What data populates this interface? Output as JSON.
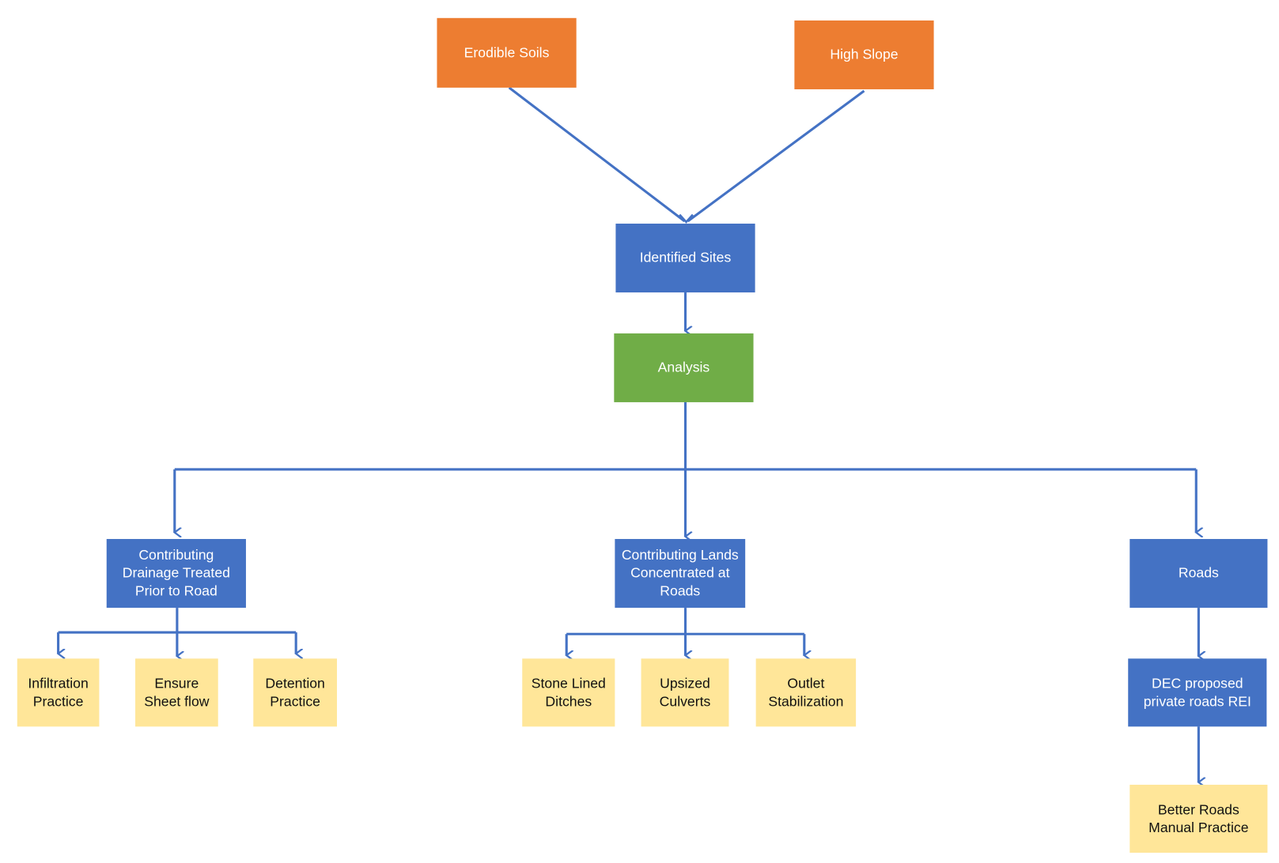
{
  "colors": {
    "source": "#ED7D31",
    "process": "#4472C4",
    "analysis": "#70AD47",
    "practice": "#FFE699",
    "connector": "#4472C4"
  },
  "nodes": {
    "erodible_soils": "Erodible Soils",
    "high_slope": "High Slope",
    "identified_sites": "Identified Sites",
    "analysis": "Analysis",
    "contributing_drainage": "Contributing\nDrainage Treated\nPrior to Road",
    "contributing_lands": "Contributing Lands\nConcentrated at\nRoads",
    "roads": "Roads",
    "infiltration": "Infiltration\nPractice",
    "ensure_sheet_flow": "Ensure\nSheet flow",
    "detention": "Detention\nPractice",
    "stone_lined_ditches": "Stone Lined\nDitches",
    "upsized_culverts": "Upsized\nCulverts",
    "outlet_stabilization": "Outlet\nStabilization",
    "dec_proposed": "DEC proposed\nprivate roads REI",
    "better_roads": "Better Roads\nManual Practice"
  }
}
